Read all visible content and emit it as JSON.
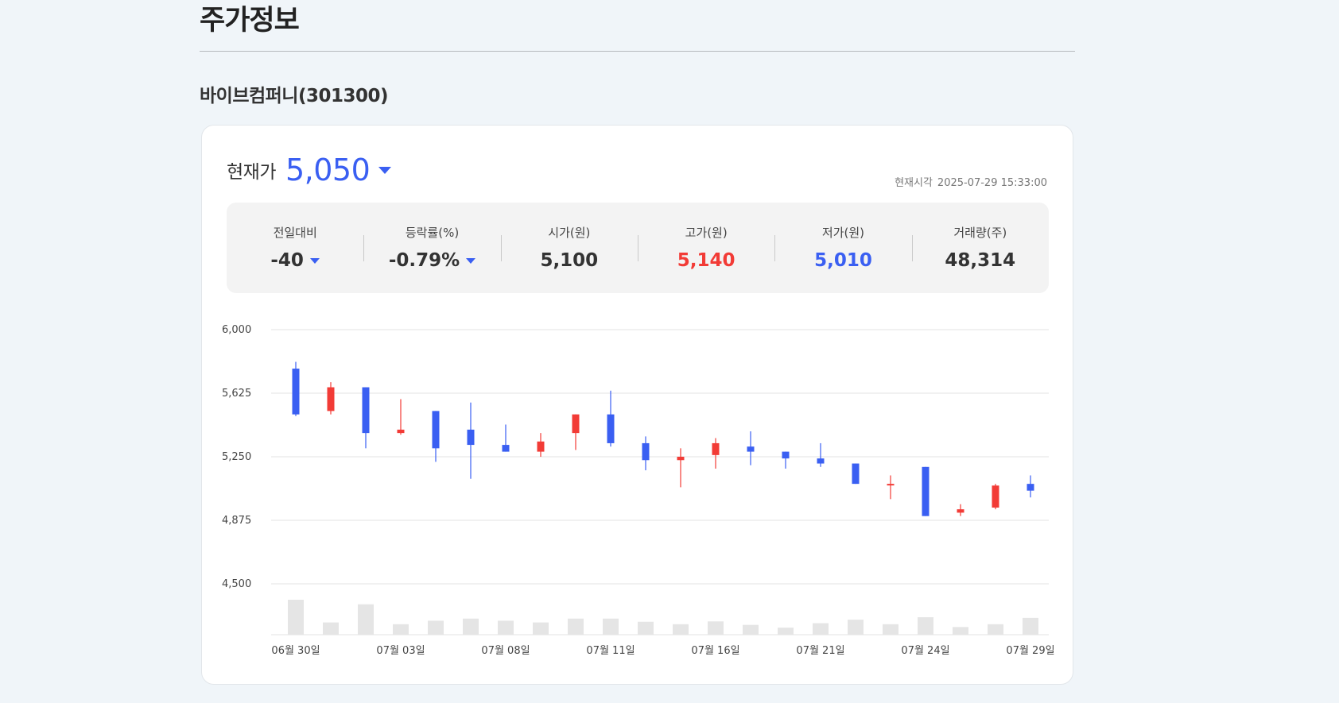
{
  "header": {
    "title": "주가정보"
  },
  "stock": {
    "name": "바이브컴퍼니(301300)"
  },
  "price": {
    "label": "현재가",
    "value": "5,050",
    "time_label": "현재시각",
    "time_value": "2025-07-29 15:33:00"
  },
  "stats": [
    {
      "label": "전일대비",
      "value": "-40",
      "direction": "down"
    },
    {
      "label": "등락률(%)",
      "value": "-0.79%",
      "direction": "down"
    },
    {
      "label": "시가(원)",
      "value": "5,100",
      "direction": "none"
    },
    {
      "label": "고가(원)",
      "value": "5,140",
      "direction": "up-color"
    },
    {
      "label": "저가(원)",
      "value": "5,010",
      "direction": "down-color"
    },
    {
      "label": "거래량(주)",
      "value": "48,314",
      "direction": "none"
    }
  ],
  "colors": {
    "up": "#f23b36",
    "down": "#3a5ff2",
    "volume": "#e5e5e5",
    "grid": "#e3e3e3"
  },
  "icons": {
    "price_direction": "triangle-down-icon"
  },
  "chart_data": {
    "type": "candlestick",
    "ylim": [
      4500,
      6000
    ],
    "yticks": [
      "6,000",
      "5,625",
      "5,250",
      "4,875",
      "4,500"
    ],
    "yticks_values": [
      6000,
      5625,
      5250,
      4875,
      4500
    ],
    "xtick_labels": [
      "06월 30일",
      "07월 03일",
      "07월 08일",
      "07월 11일",
      "07월 16일",
      "07월 21일",
      "07월 24일",
      "07월 29일"
    ],
    "xtick_indices": [
      0,
      3,
      6,
      9,
      12,
      15,
      18,
      21
    ],
    "grid": true,
    "candles": [
      {
        "open": 5770,
        "high": 5810,
        "low": 5490,
        "close": 5500,
        "volume": 1.0
      },
      {
        "open": 5520,
        "high": 5690,
        "low": 5500,
        "close": 5660,
        "volume": 0.35
      },
      {
        "open": 5660,
        "high": 5660,
        "low": 5300,
        "close": 5390,
        "volume": 0.87
      },
      {
        "open": 5390,
        "high": 5590,
        "low": 5380,
        "close": 5410,
        "volume": 0.3
      },
      {
        "open": 5520,
        "high": 5520,
        "low": 5220,
        "close": 5300,
        "volume": 0.4
      },
      {
        "open": 5410,
        "high": 5570,
        "low": 5120,
        "close": 5320,
        "volume": 0.46
      },
      {
        "open": 5320,
        "high": 5440,
        "low": 5280,
        "close": 5280,
        "volume": 0.4
      },
      {
        "open": 5280,
        "high": 5390,
        "low": 5250,
        "close": 5340,
        "volume": 0.35
      },
      {
        "open": 5390,
        "high": 5500,
        "low": 5290,
        "close": 5500,
        "volume": 0.46
      },
      {
        "open": 5500,
        "high": 5640,
        "low": 5310,
        "close": 5330,
        "volume": 0.46
      },
      {
        "open": 5330,
        "high": 5370,
        "low": 5170,
        "close": 5230,
        "volume": 0.37
      },
      {
        "open": 5230,
        "high": 5300,
        "low": 5070,
        "close": 5250,
        "volume": 0.3
      },
      {
        "open": 5260,
        "high": 5360,
        "low": 5180,
        "close": 5330,
        "volume": 0.38
      },
      {
        "open": 5310,
        "high": 5400,
        "low": 5200,
        "close": 5280,
        "volume": 0.28
      },
      {
        "open": 5280,
        "high": 5280,
        "low": 5180,
        "close": 5240,
        "volume": 0.2
      },
      {
        "open": 5240,
        "high": 5330,
        "low": 5190,
        "close": 5210,
        "volume": 0.33
      },
      {
        "open": 5210,
        "high": 5210,
        "low": 5090,
        "close": 5090,
        "volume": 0.43
      },
      {
        "open": 5090,
        "high": 5140,
        "low": 5000,
        "close": 5090,
        "volume": 0.3
      },
      {
        "open": 5190,
        "high": 5190,
        "low": 4900,
        "close": 4900,
        "volume": 0.5
      },
      {
        "open": 4920,
        "high": 4970,
        "low": 4900,
        "close": 4940,
        "volume": 0.22
      },
      {
        "open": 4950,
        "high": 5090,
        "low": 4940,
        "close": 5080,
        "volume": 0.3
      },
      {
        "open": 5090,
        "high": 5140,
        "low": 5010,
        "close": 5050,
        "volume": 0.48
      }
    ]
  }
}
